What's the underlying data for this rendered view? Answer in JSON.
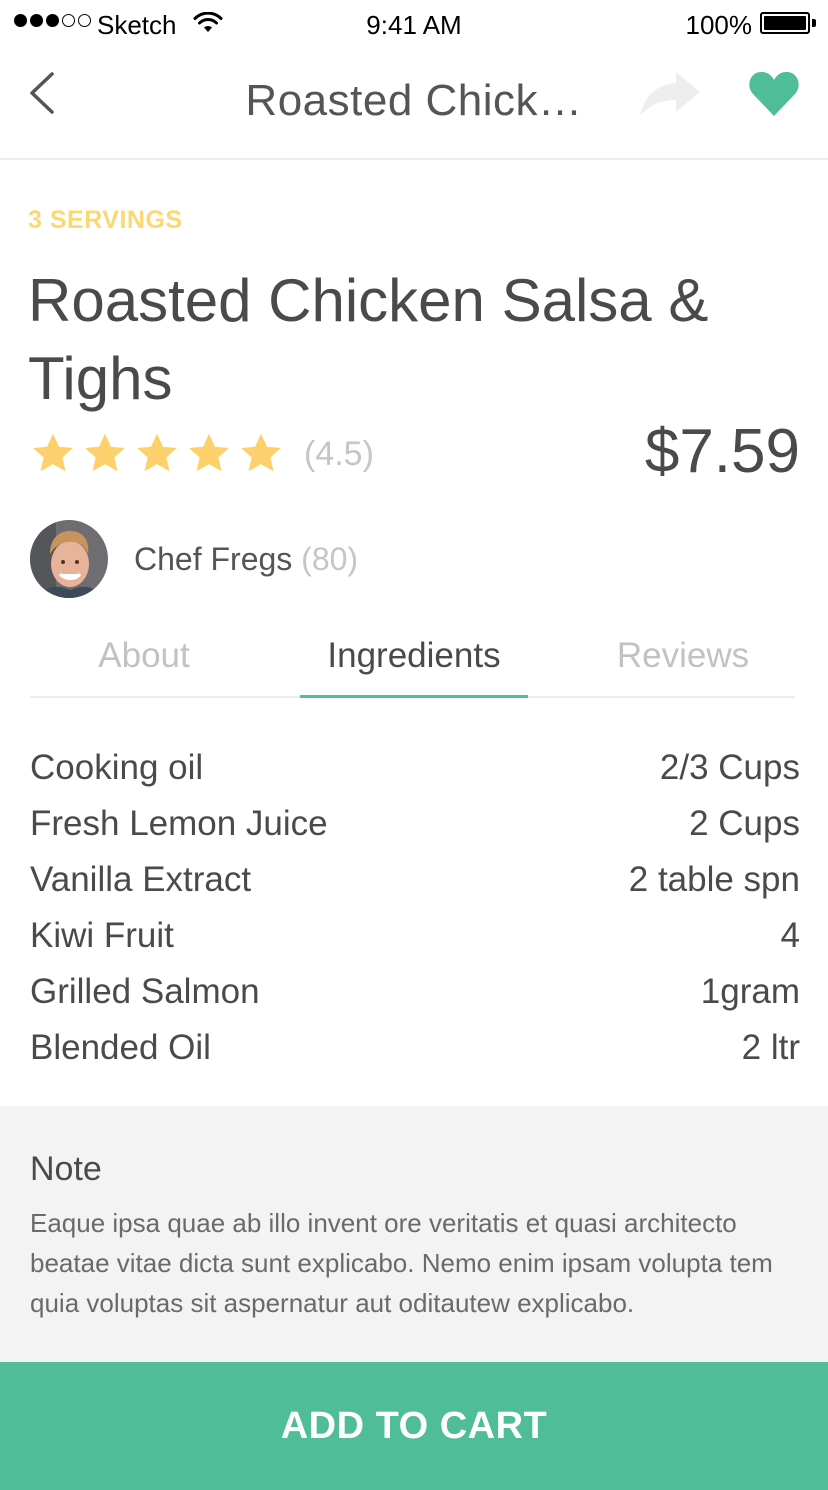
{
  "status_bar": {
    "carrier": "Sketch",
    "time": "9:41 AM",
    "battery": "100%"
  },
  "nav": {
    "title": "Roasted Chick…",
    "back_icon": "chevron-left-icon",
    "share_icon": "share-arrow-icon",
    "favorite_icon": "heart-icon",
    "favorite_active": true
  },
  "recipe": {
    "servings": "3 SERVINGS",
    "title": "Roasted Chicken Salsa & Tighs",
    "rating_stars": 5,
    "rating_text": "(4.5)",
    "price": "$7.59",
    "chef_name": "Chef Fregs",
    "chef_count": "(80)"
  },
  "tabs": [
    {
      "label": "About",
      "active": false
    },
    {
      "label": "Ingredients",
      "active": true
    },
    {
      "label": "Reviews",
      "active": false
    }
  ],
  "ingredients": [
    {
      "name": "Cooking oil",
      "qty": "2/3 Cups"
    },
    {
      "name": "Fresh Lemon Juice",
      "qty": "2 Cups"
    },
    {
      "name": "Vanilla Extract",
      "qty": "2 table spn"
    },
    {
      "name": "Kiwi Fruit",
      "qty": "4"
    },
    {
      "name": "Grilled Salmon",
      "qty": "1gram"
    },
    {
      "name": "Blended Oil",
      "qty": "2 ltr"
    }
  ],
  "note": {
    "heading": "Note",
    "body": "Eaque ipsa quae ab illo invent ore veritatis et quasi architecto beatae vitae dicta sunt explicabo. Nemo enim ipsam volupta tem quia voluptas sit aspernatur aut oditautew explicabo."
  },
  "cta": {
    "label": "ADD TO CART"
  },
  "colors": {
    "accent": "#4fbd97",
    "servings": "#fcd873",
    "star": "#fcd16b"
  }
}
